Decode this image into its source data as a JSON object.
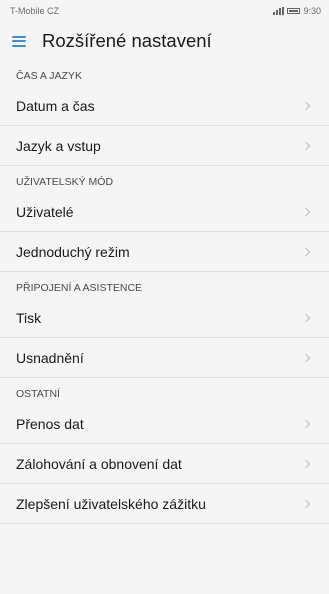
{
  "status": {
    "carrier": "T-Mobile CZ",
    "time": "9:30"
  },
  "header": {
    "title": "Rozšířené nastavení"
  },
  "sections": [
    {
      "title": "ČAS A JAZYK",
      "items": [
        {
          "label": "Datum a čas"
        },
        {
          "label": "Jazyk a vstup"
        }
      ]
    },
    {
      "title": "UŽIVATELSKÝ MÓD",
      "items": [
        {
          "label": "Uživatelé"
        },
        {
          "label": "Jednoduchý režim"
        }
      ]
    },
    {
      "title": "PŘIPOJENÍ A ASISTENCE",
      "items": [
        {
          "label": "Tisk"
        },
        {
          "label": "Usnadnění"
        }
      ]
    },
    {
      "title": "OSTATNÍ",
      "items": [
        {
          "label": "Přenos dat"
        },
        {
          "label": "Zálohování a obnovení dat"
        },
        {
          "label": "Zlepšení uživatelského zážitku"
        }
      ]
    }
  ],
  "colors": {
    "accent": "#3a8fd6"
  }
}
